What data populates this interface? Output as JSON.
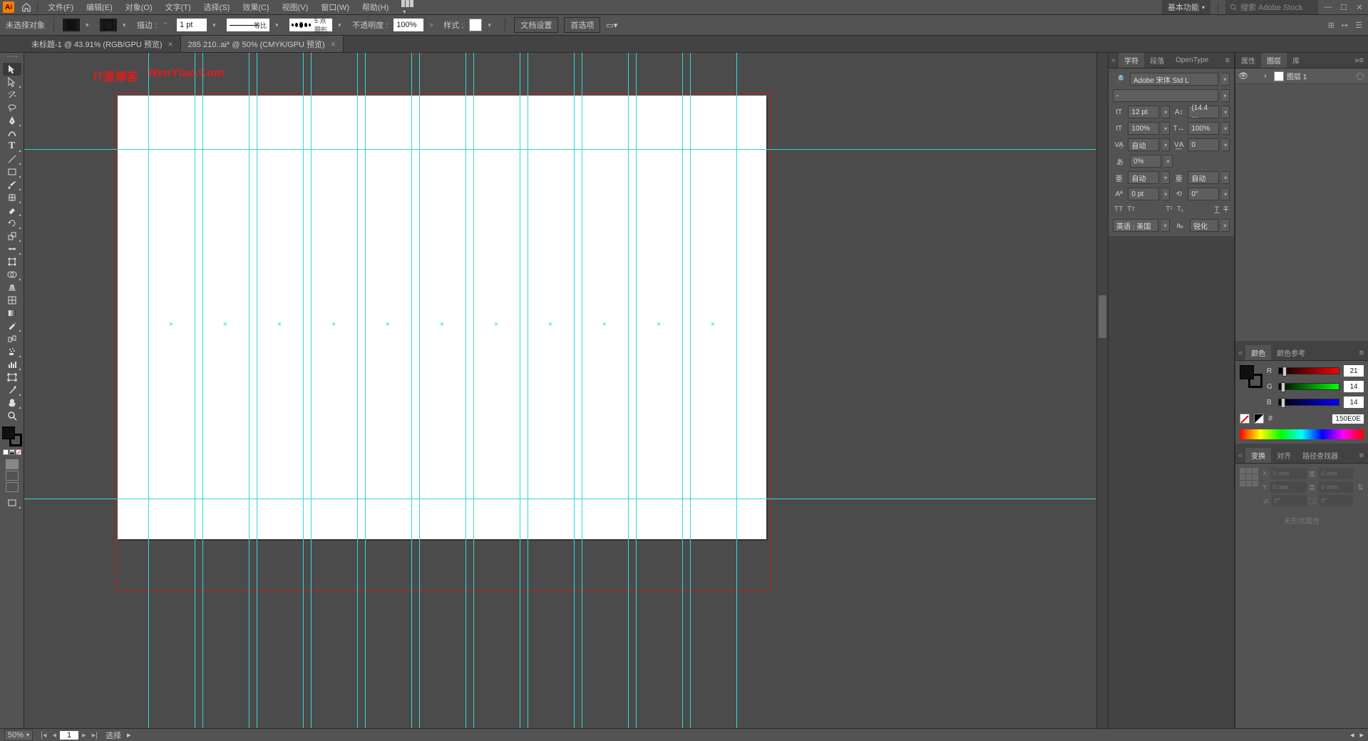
{
  "menu": {
    "items": [
      "文件(F)",
      "编辑(E)",
      "对象(O)",
      "文字(T)",
      "选择(S)",
      "效果(C)",
      "视图(V)",
      "窗口(W)",
      "帮助(H)"
    ],
    "workspace": "基本功能",
    "search_placeholder": "搜索 Adobe Stock"
  },
  "optbar": {
    "no_selection": "未选择对象",
    "stroke_label": "描边 :",
    "stroke_weight": "1 pt",
    "uniform_label": "等比",
    "profile_label": "5 点圆形",
    "opacity_label": "不透明度 :",
    "opacity_value": "100%",
    "style_label": "样式 :",
    "doc_setup": "文档设置",
    "prefs": "首选项"
  },
  "tabs": [
    {
      "label": "未标题-1 @ 43.91% (RGB/GPU 预览)",
      "active": false
    },
    {
      "label": "285 210..ai* @ 50% (CMYK/GPU 预览)",
      "active": true
    }
  ],
  "watermark": {
    "a": "IT屋博客",
    "b": "WenYtao.Com"
  },
  "char_panel": {
    "tabs": [
      "字符",
      "段落",
      "OpenType"
    ],
    "font": "Adobe 宋体 Std L",
    "style": "-",
    "size": "12 pt",
    "leading": "(14.4 …",
    "vscale": "100%",
    "hscale": "100%",
    "kerning": "自动",
    "tracking": "0",
    "baseline_shift_pct": "0%",
    "tsume_a": "自动",
    "tsume_b": "自动",
    "baseline": "0 pt",
    "rotation": "0°",
    "lang": "英语 : 美国",
    "aa": "锐化"
  },
  "layer_panel": {
    "tabs": [
      "属性",
      "图层",
      "库"
    ],
    "layer_name": "图层 1"
  },
  "color_panel": {
    "tabs": [
      "颜色",
      "颜色参考"
    ],
    "r": "21",
    "g": "14",
    "b": "14",
    "hex": "150E0E"
  },
  "transform_panel": {
    "tabs": [
      "变换",
      "对齐",
      "路径查找器"
    ],
    "x": "0 mm",
    "y": "0 mm",
    "w": "0 mm",
    "h": "0 mm",
    "angle": "0°",
    "shear": "0°",
    "noshape": "无形状属性"
  },
  "status": {
    "zoom": "50%",
    "page": "1",
    "tool": "选择"
  }
}
